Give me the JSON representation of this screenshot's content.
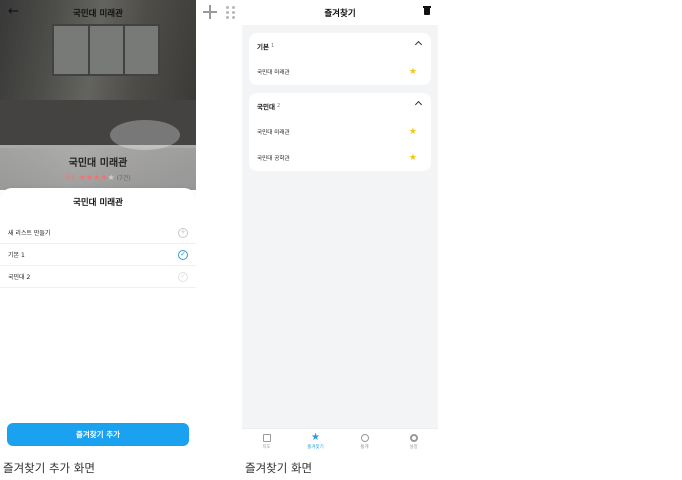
{
  "left_screen": {
    "header_title": "국민대 미래관",
    "back_icon": "arrow-left-icon",
    "place_name": "국민대 미래관",
    "rating_score": "3.9",
    "rating_stars_filled": 4,
    "rating_stars_total": 5,
    "review_count": "(7건)",
    "sheet": {
      "title": "국민대 미래관",
      "rows": [
        {
          "label": "새 리스트 만들기",
          "icon": "add-circle-icon",
          "state": "empty"
        },
        {
          "label": "기본 1",
          "icon": "check-circle-icon",
          "state": "checked"
        },
        {
          "label": "국민대 2",
          "icon": "check-circle-icon",
          "state": "faint"
        }
      ],
      "add_button_label": "즐겨찾기 추가"
    },
    "caption": "즐겨찾기 추가 화면"
  },
  "right_screen": {
    "header_title": "즐겨찾기",
    "trash_icon": "trash-icon",
    "groups": [
      {
        "name": "기본",
        "count": "1",
        "items": [
          "국민대 미래관"
        ]
      },
      {
        "name": "국민대",
        "count": "2",
        "items": [
          "국민대 미래관",
          "국민대 공학관"
        ]
      }
    ],
    "tabs": [
      {
        "label": "지도",
        "icon": "map-icon",
        "active": false
      },
      {
        "label": "즐겨찾기",
        "icon": "star-icon",
        "active": true
      },
      {
        "label": "통계",
        "icon": "chart-icon",
        "active": false
      },
      {
        "label": "설정",
        "icon": "gear-icon",
        "active": false
      }
    ],
    "caption": "즐겨찾기 화면"
  },
  "colors": {
    "accent": "#1aa1f0",
    "check": "#2f9bd6",
    "star": "#f5c518",
    "rating": "#ff6b6b",
    "background_gray": "#f3f4f6"
  }
}
